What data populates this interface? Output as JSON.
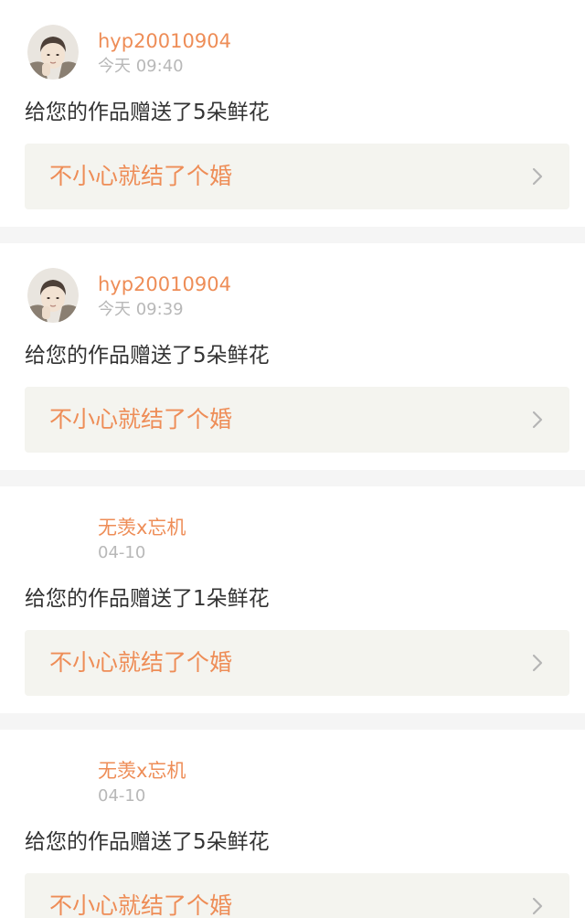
{
  "notifications": [
    {
      "user": "hyp20010904",
      "time": "今天 09:40",
      "message": "给您的作品赠送了5朵鲜花",
      "work_title": "不小心就结了个婚",
      "has_avatar": true
    },
    {
      "user": "hyp20010904",
      "time": "今天 09:39",
      "message": "给您的作品赠送了5朵鲜花",
      "work_title": "不小心就结了个婚",
      "has_avatar": true
    },
    {
      "user": "无羡x忘机",
      "time": "04-10",
      "message": "给您的作品赠送了1朵鲜花",
      "work_title": "不小心就结了个婚",
      "has_avatar": false
    },
    {
      "user": "无羡x忘机",
      "time": "04-10",
      "message": "给您的作品赠送了5朵鲜花",
      "work_title": "不小心就结了个婚",
      "has_avatar": false
    }
  ],
  "colors": {
    "accent": "#ee8d57",
    "muted": "#b8b8b8",
    "text": "#333333",
    "link_bg": "#f4f4ef",
    "page_bg": "#f5f5f5"
  },
  "icons": {
    "chevron": "chevron-right-icon"
  }
}
